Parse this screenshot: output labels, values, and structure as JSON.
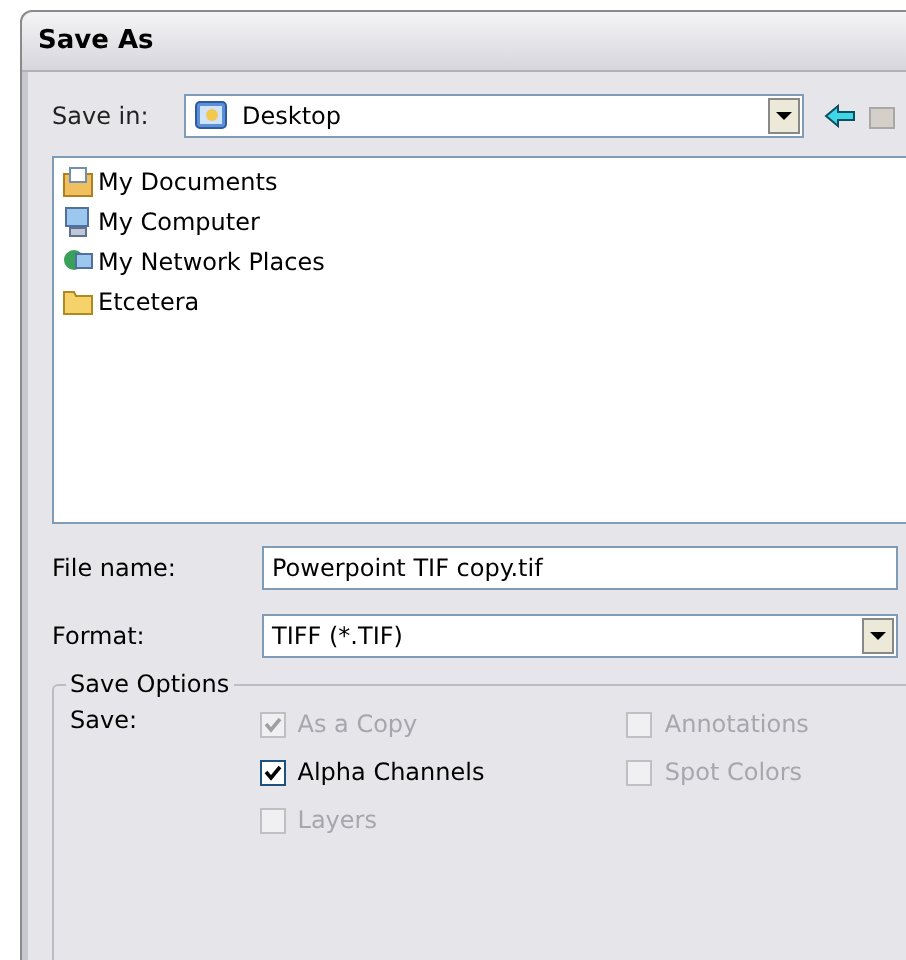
{
  "window": {
    "title": "Save As"
  },
  "save_in": {
    "label": "Save in:",
    "value": "Desktop"
  },
  "files": [
    {
      "name": "My Documents",
      "kind": "documents"
    },
    {
      "name": "My Computer",
      "kind": "computer"
    },
    {
      "name": "My Network Places",
      "kind": "network"
    },
    {
      "name": "Etcetera",
      "kind": "folder"
    }
  ],
  "file_name": {
    "label": "File name:",
    "value": "Powerpoint TIF copy.tif"
  },
  "format": {
    "label": "Format:",
    "value": "TIFF (*.TIF)"
  },
  "save_options": {
    "title": "Save Options",
    "label": "Save:",
    "columns": [
      [
        {
          "label": "As a Copy",
          "checked": true,
          "disabled": true
        },
        {
          "label": "Alpha Channels",
          "checked": true,
          "disabled": false
        },
        {
          "label": "Layers",
          "checked": false,
          "disabled": true
        }
      ],
      [
        {
          "label": "Annotations",
          "checked": false,
          "disabled": true
        },
        {
          "label": "Spot Colors",
          "checked": false,
          "disabled": true
        }
      ]
    ]
  }
}
